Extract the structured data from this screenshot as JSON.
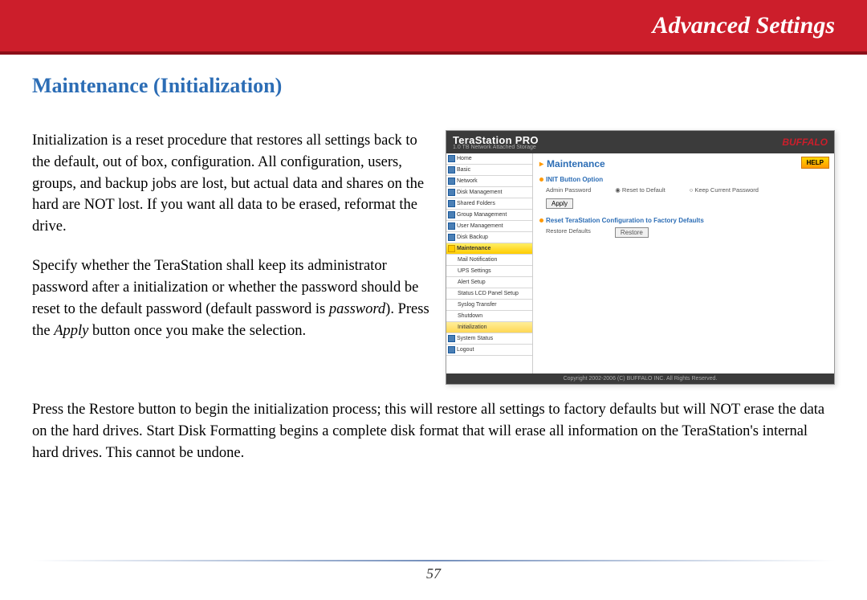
{
  "header": {
    "title": "Advanced Settings"
  },
  "section_title": "Maintenance (Initialization)",
  "paragraphs": {
    "p1": "Initialization is a reset procedure that restores all settings back to the default, out of box, configuration.  All configuration, users, groups, and backup jobs are lost, but actual data and shares on the hard are NOT lost.  If you want all data to be erased, reformat the drive.",
    "p2a": "Specify whether the TeraStation shall keep its administrator password after a initialization or whether the password should be reset to the default password (default password is ",
    "p2_em1": "password",
    "p2b": ").   Press the ",
    "p2_em2": "Apply",
    "p2c": " button once you make the selection.",
    "p3a": "Press the ",
    "p3_em1": "Restore",
    "p3b": " button to begin the initialization process; this will restore all settings to factory defaults but will NOT erase the data on the hard drives.  ",
    "p3_em2": "Start Disk Formatting",
    "p3c": " begins a complete disk format that will erase all information on the TeraStation's internal hard drives.  This cannot be undone."
  },
  "screenshot": {
    "product": "TeraStation PRO",
    "product_sub": "1.0 TB Network Attached Storage",
    "brand": "BUFFALO",
    "help": "HELP",
    "main_title": "Maintenance",
    "nav": [
      "Home",
      "Basic",
      "Network",
      "Disk Management",
      "Shared Folders",
      "Group Management",
      "User Management",
      "Disk Backup",
      "Maintenance",
      "Mail Notification",
      "UPS Settings",
      "Alert Setup",
      "Status LCD Panel Setup",
      "Syslog Transfer",
      "Shutdown",
      "Initialization",
      "System Status",
      "Logout"
    ],
    "section1_title": "INIT Button Option",
    "section1_label": "Admin Password",
    "section1_opt1": "Reset to Default",
    "section1_opt2": "Keep Current Password",
    "apply_btn": "Apply",
    "section2_title": "Reset TeraStation Configuration to Factory Defaults",
    "section2_label": "Restore Defaults",
    "restore_btn": "Restore",
    "footer": "Copyright 2002-2006 (C) BUFFALO INC. All Rights Reserved."
  },
  "page_number": "57"
}
